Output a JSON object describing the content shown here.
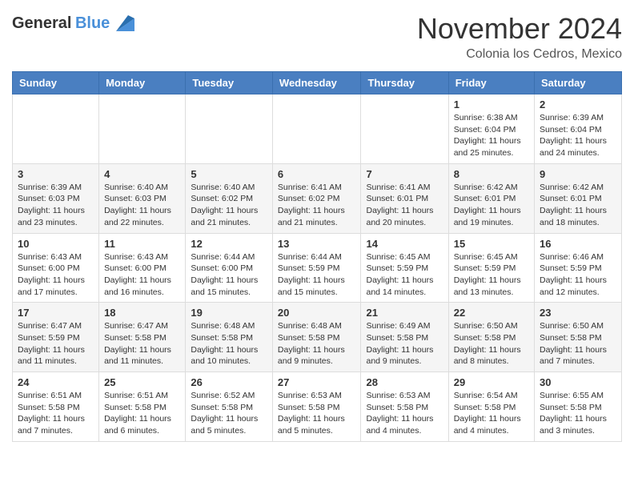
{
  "logo": {
    "general": "General",
    "blue": "Blue"
  },
  "header": {
    "month": "November 2024",
    "location": "Colonia los Cedros, Mexico"
  },
  "weekdays": [
    "Sunday",
    "Monday",
    "Tuesday",
    "Wednesday",
    "Thursday",
    "Friday",
    "Saturday"
  ],
  "weeks": [
    {
      "rowStyle": "row-white",
      "days": [
        {
          "num": "",
          "info": ""
        },
        {
          "num": "",
          "info": ""
        },
        {
          "num": "",
          "info": ""
        },
        {
          "num": "",
          "info": ""
        },
        {
          "num": "",
          "info": ""
        },
        {
          "num": "1",
          "info": "Sunrise: 6:38 AM\nSunset: 6:04 PM\nDaylight: 11 hours and 25 minutes."
        },
        {
          "num": "2",
          "info": "Sunrise: 6:39 AM\nSunset: 6:04 PM\nDaylight: 11 hours and 24 minutes."
        }
      ]
    },
    {
      "rowStyle": "row-gray",
      "days": [
        {
          "num": "3",
          "info": "Sunrise: 6:39 AM\nSunset: 6:03 PM\nDaylight: 11 hours and 23 minutes."
        },
        {
          "num": "4",
          "info": "Sunrise: 6:40 AM\nSunset: 6:03 PM\nDaylight: 11 hours and 22 minutes."
        },
        {
          "num": "5",
          "info": "Sunrise: 6:40 AM\nSunset: 6:02 PM\nDaylight: 11 hours and 21 minutes."
        },
        {
          "num": "6",
          "info": "Sunrise: 6:41 AM\nSunset: 6:02 PM\nDaylight: 11 hours and 21 minutes."
        },
        {
          "num": "7",
          "info": "Sunrise: 6:41 AM\nSunset: 6:01 PM\nDaylight: 11 hours and 20 minutes."
        },
        {
          "num": "8",
          "info": "Sunrise: 6:42 AM\nSunset: 6:01 PM\nDaylight: 11 hours and 19 minutes."
        },
        {
          "num": "9",
          "info": "Sunrise: 6:42 AM\nSunset: 6:01 PM\nDaylight: 11 hours and 18 minutes."
        }
      ]
    },
    {
      "rowStyle": "row-white",
      "days": [
        {
          "num": "10",
          "info": "Sunrise: 6:43 AM\nSunset: 6:00 PM\nDaylight: 11 hours and 17 minutes."
        },
        {
          "num": "11",
          "info": "Sunrise: 6:43 AM\nSunset: 6:00 PM\nDaylight: 11 hours and 16 minutes."
        },
        {
          "num": "12",
          "info": "Sunrise: 6:44 AM\nSunset: 6:00 PM\nDaylight: 11 hours and 15 minutes."
        },
        {
          "num": "13",
          "info": "Sunrise: 6:44 AM\nSunset: 5:59 PM\nDaylight: 11 hours and 15 minutes."
        },
        {
          "num": "14",
          "info": "Sunrise: 6:45 AM\nSunset: 5:59 PM\nDaylight: 11 hours and 14 minutes."
        },
        {
          "num": "15",
          "info": "Sunrise: 6:45 AM\nSunset: 5:59 PM\nDaylight: 11 hours and 13 minutes."
        },
        {
          "num": "16",
          "info": "Sunrise: 6:46 AM\nSunset: 5:59 PM\nDaylight: 11 hours and 12 minutes."
        }
      ]
    },
    {
      "rowStyle": "row-gray",
      "days": [
        {
          "num": "17",
          "info": "Sunrise: 6:47 AM\nSunset: 5:59 PM\nDaylight: 11 hours and 11 minutes."
        },
        {
          "num": "18",
          "info": "Sunrise: 6:47 AM\nSunset: 5:58 PM\nDaylight: 11 hours and 11 minutes."
        },
        {
          "num": "19",
          "info": "Sunrise: 6:48 AM\nSunset: 5:58 PM\nDaylight: 11 hours and 10 minutes."
        },
        {
          "num": "20",
          "info": "Sunrise: 6:48 AM\nSunset: 5:58 PM\nDaylight: 11 hours and 9 minutes."
        },
        {
          "num": "21",
          "info": "Sunrise: 6:49 AM\nSunset: 5:58 PM\nDaylight: 11 hours and 9 minutes."
        },
        {
          "num": "22",
          "info": "Sunrise: 6:50 AM\nSunset: 5:58 PM\nDaylight: 11 hours and 8 minutes."
        },
        {
          "num": "23",
          "info": "Sunrise: 6:50 AM\nSunset: 5:58 PM\nDaylight: 11 hours and 7 minutes."
        }
      ]
    },
    {
      "rowStyle": "row-white",
      "days": [
        {
          "num": "24",
          "info": "Sunrise: 6:51 AM\nSunset: 5:58 PM\nDaylight: 11 hours and 7 minutes."
        },
        {
          "num": "25",
          "info": "Sunrise: 6:51 AM\nSunset: 5:58 PM\nDaylight: 11 hours and 6 minutes."
        },
        {
          "num": "26",
          "info": "Sunrise: 6:52 AM\nSunset: 5:58 PM\nDaylight: 11 hours and 5 minutes."
        },
        {
          "num": "27",
          "info": "Sunrise: 6:53 AM\nSunset: 5:58 PM\nDaylight: 11 hours and 5 minutes."
        },
        {
          "num": "28",
          "info": "Sunrise: 6:53 AM\nSunset: 5:58 PM\nDaylight: 11 hours and 4 minutes."
        },
        {
          "num": "29",
          "info": "Sunrise: 6:54 AM\nSunset: 5:58 PM\nDaylight: 11 hours and 4 minutes."
        },
        {
          "num": "30",
          "info": "Sunrise: 6:55 AM\nSunset: 5:58 PM\nDaylight: 11 hours and 3 minutes."
        }
      ]
    }
  ]
}
